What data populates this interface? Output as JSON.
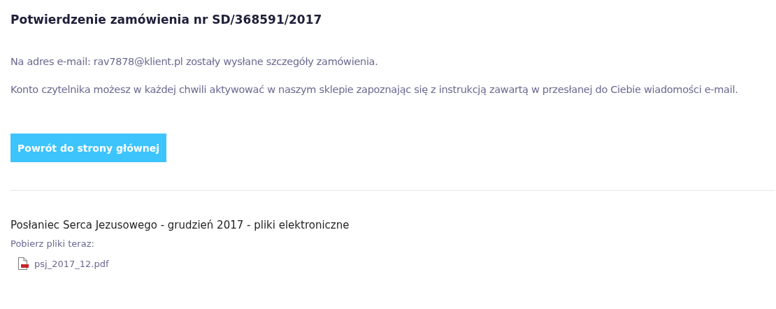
{
  "title": "Potwierdzenie zamówienia nr SD/368591/2017",
  "paragraphs": [
    "Na adres e-mail: rav7878@klient.pl zostały wysłane szczegóły zamówienia.",
    "Konto czytelnika możesz w każdej chwili aktywować w naszym sklepie zapoznając się z instrukcją zawartą w przesłanej do Ciebie wiadomości e-mail."
  ],
  "button": "Powrót do strony głównej",
  "product": {
    "title": "Posłaniec Serca Jezusowego - grudzień 2017 - pliki elektroniczne",
    "download_label": "Pobierz pliki teraz:",
    "files": [
      {
        "name": "psj_2017_12.pdf",
        "kind": "pdf"
      }
    ]
  }
}
